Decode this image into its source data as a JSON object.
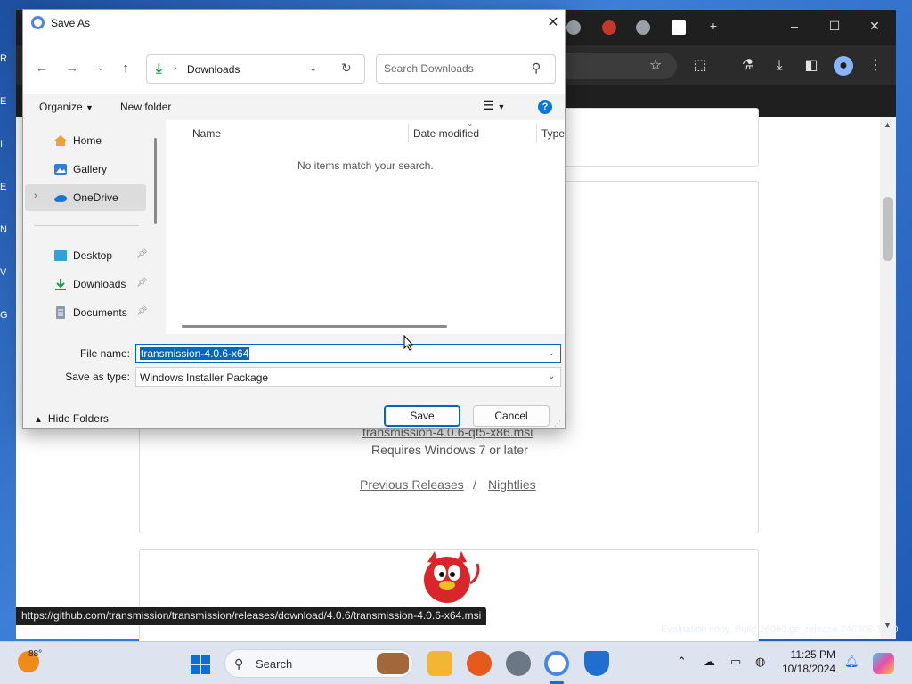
{
  "desktop": {
    "evaluation_text": "Evaluation copy. Build 26080.ge_release.240308-1400"
  },
  "browser": {
    "status_url": "https://github.com/transmission/transmission/releases/download/4.0.6/transmission-4.0.6-x64.msi",
    "page": {
      "partial_link": "transmission-4.0.6-qt5-x86.msi",
      "requirement": "Requires Windows 7 or later",
      "previous_releases": "Previous Releases",
      "separator": "/",
      "nightlies": "Nightlies"
    }
  },
  "dialog": {
    "title": "Save As",
    "address": {
      "current_folder": "Downloads"
    },
    "search": {
      "placeholder": "Search Downloads"
    },
    "commands": {
      "organize": "Organize",
      "new_folder": "New folder"
    },
    "nav_pane": {
      "items": [
        {
          "label": "Home",
          "icon": "home-icon"
        },
        {
          "label": "Gallery",
          "icon": "gallery-icon"
        },
        {
          "label": "OneDrive",
          "icon": "cloud-icon",
          "selected": true
        },
        {
          "label": "Desktop",
          "icon": "desktop-icon",
          "pinned": true
        },
        {
          "label": "Downloads",
          "icon": "download-icon",
          "pinned": true
        },
        {
          "label": "Documents",
          "icon": "document-icon",
          "pinned": true
        }
      ]
    },
    "file_list": {
      "columns": [
        "Name",
        "Date modified",
        "Type"
      ],
      "empty_message": "No items match your search."
    },
    "fields": {
      "file_name_label": "File name:",
      "file_name_value": "transmission-4.0.6-x64",
      "save_as_type_label": "Save as type:",
      "save_as_type_value": "Windows Installer Package"
    },
    "footer": {
      "hide_folders": "Hide Folders",
      "save": "Save",
      "cancel": "Cancel"
    }
  },
  "taskbar": {
    "weather_temp": "88°",
    "search_label": "Search",
    "clock_time": "11:25 PM",
    "clock_date": "10/18/2024"
  },
  "colors": {
    "accent": "#0067c0",
    "download_green": "#1a9b4c"
  }
}
